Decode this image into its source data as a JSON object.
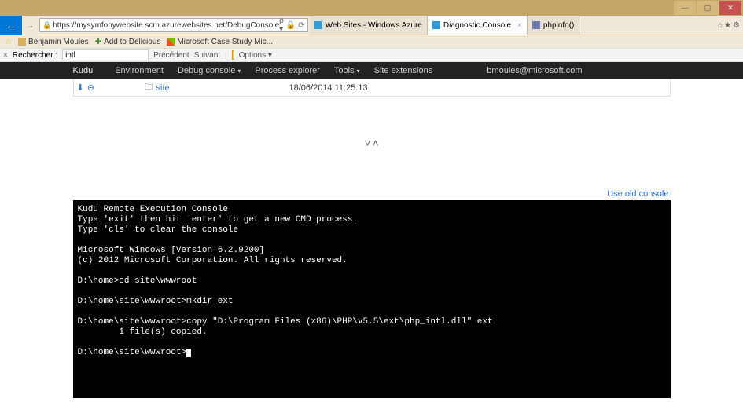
{
  "window": {
    "min": "—",
    "max": "▢",
    "close": "✕"
  },
  "browser": {
    "url": "https://mysymfonywebsite.scm.azurewebsites.net/DebugConsole",
    "search_glyph": "🔍",
    "lock_glyph": "🔒",
    "refresh_glyph": "⟳",
    "tabs": [
      {
        "label": "Web Sites - Windows Azure"
      },
      {
        "label": "Diagnostic Console"
      },
      {
        "label": "phpinfo()"
      }
    ],
    "sys": {
      "home": "⌂",
      "star": "★",
      "gear": "⚙"
    }
  },
  "bookmarks": {
    "items": [
      {
        "icon": "⬚",
        "label": "Benjamin Moules"
      },
      {
        "icon": "✚",
        "label": "Add to Delicious"
      },
      {
        "icon": "▦",
        "label": "Microsoft Case Study Mic..."
      }
    ],
    "star": "☆"
  },
  "findbar": {
    "close": "×",
    "label": "Rechercher :",
    "value": "intl",
    "prev": "Précédent",
    "next": "Suivant",
    "options": "Options",
    "caret": "▾"
  },
  "kudu": {
    "brand": "Kudu",
    "nav": {
      "env": "Environment",
      "debug": "Debug console",
      "proc": "Process explorer",
      "tools": "Tools",
      "ext": "Site extensions"
    },
    "user": "bmoules@microsoft.com"
  },
  "files": {
    "row": {
      "download": "⬇",
      "delete": "⊖",
      "folder": "🗀",
      "name": "site",
      "date": "18/06/2014 11:25:13"
    }
  },
  "splitter": {
    "down": "˅",
    "up": "˄"
  },
  "console": {
    "old_link": "Use old console",
    "text": "Kudu Remote Execution Console\nType 'exit' then hit 'enter' to get a new CMD process.\nType 'cls' to clear the console\n\nMicrosoft Windows [Version 6.2.9200]\n(c) 2012 Microsoft Corporation. All rights reserved.\n\nD:\\home>cd site\\wwwroot\n\nD:\\home\\site\\wwwroot>mkdir ext\n\nD:\\home\\site\\wwwroot>copy \"D:\\Program Files (x86)\\PHP\\v5.5\\ext\\php_intl.dll\" ext\n        1 file(s) copied.\n\nD:\\home\\site\\wwwroot>"
  }
}
